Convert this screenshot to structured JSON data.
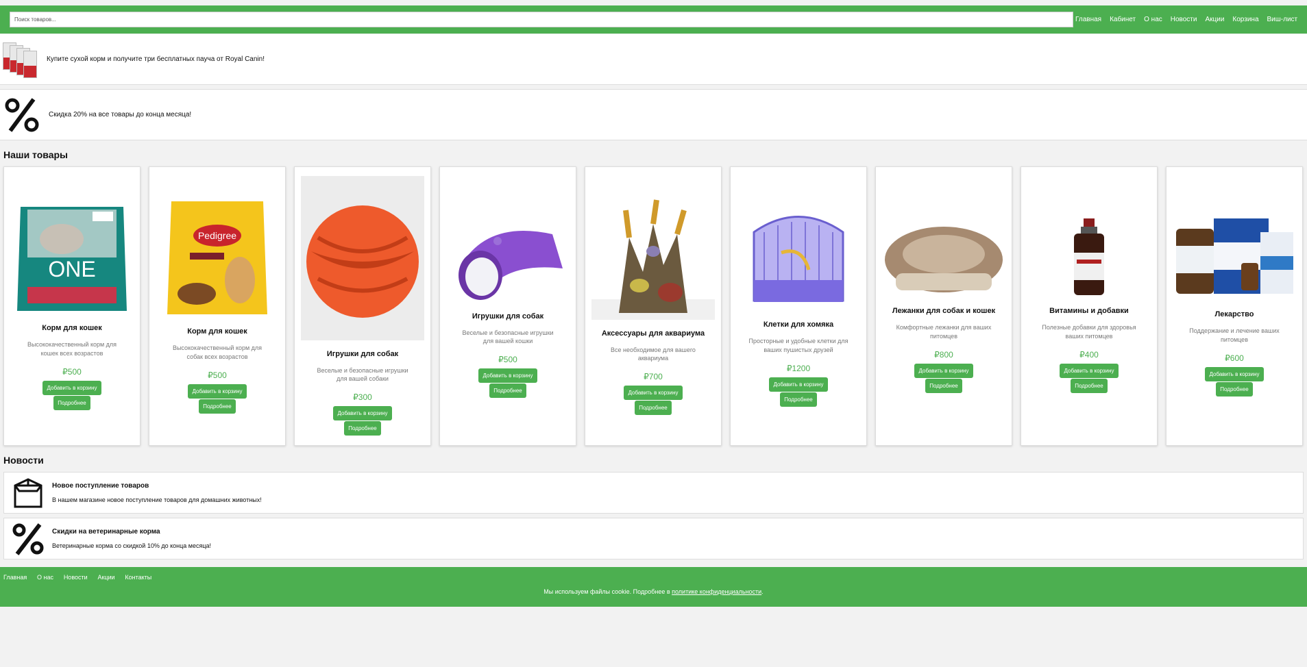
{
  "header": {
    "search_placeholder": "Поиск товаров...",
    "menu": [
      "Главная",
      "Кабинет",
      "О нас",
      "Новости",
      "Акции",
      "Корзина",
      "Виш-лист"
    ],
    "accent_color": "#4caf50"
  },
  "promos": [
    {
      "text": "Купите сухой корм и получите три бесплатных пауча от Royal Canin!"
    },
    {
      "text": "Скидка 20% на все товары до конца месяца!"
    }
  ],
  "products_section": {
    "title": "Наши товары",
    "add_label": "Добавить в корзину",
    "details_label": "Подробнее",
    "items": [
      {
        "name": "Корм для кошек",
        "desc": "Высококачественный корм для кошек всех возрастов",
        "price": "₽500",
        "icon": "purina-one-bag-image"
      },
      {
        "name": "Корм для кошек",
        "desc": "Высококачественный корм для собак всех возрастов",
        "price": "₽500",
        "icon": "pedigree-bag-image"
      },
      {
        "name": "Игрушки для собак",
        "desc": "Веселые и безопасные игрушки для вашей собаки",
        "price": "₽300",
        "icon": "orange-ball-image"
      },
      {
        "name": "Игрушки для собак",
        "desc": "Веселые и безопасные игрушки для вашей кошки",
        "price": "₽500",
        "icon": "cat-tunnel-image"
      },
      {
        "name": "Аксессуары для аквариума",
        "desc": "Все необходимое для вашего аквариума",
        "price": "₽700",
        "icon": "coral-decor-image"
      },
      {
        "name": "Клетки для хомяка",
        "desc": "Просторные и удобные клетки для ваших пушистых друзей",
        "price": "₽1200",
        "icon": "hamster-cage-image"
      },
      {
        "name": "Лежанки для собак и кошек",
        "desc": "Комфортные лежанки для ваших питомцев",
        "price": "₽800",
        "icon": "pet-bed-image"
      },
      {
        "name": "Витамины и добавки",
        "desc": "Полезные добавки для здоровья ваших питомцев",
        "price": "₽400",
        "icon": "vitamin-bottle-image"
      },
      {
        "name": "Лекарство",
        "desc": "Поддержание и лечение ваших питомцев",
        "price": "₽600",
        "icon": "medicine-boxes-image"
      }
    ]
  },
  "news_section": {
    "title": "Новости",
    "items": [
      {
        "title": "Новое поступление товаров",
        "text": "В нашем магазине новое поступление товаров для домашних животных!",
        "icon": "box-icon"
      },
      {
        "title": "Скидки на ветеринарные корма",
        "text": "Ветеринарные корма со скидкой 10% до конца месяца!",
        "icon": "percent-icon"
      }
    ]
  },
  "footer": {
    "menu": [
      "Главная",
      "О нас",
      "Новости",
      "Акции",
      "Контакты"
    ],
    "cookie_text": "Мы используем файлы cookie. Подробнее в ",
    "cookie_link": "политике конфиденциальности",
    "cookie_end": "."
  }
}
